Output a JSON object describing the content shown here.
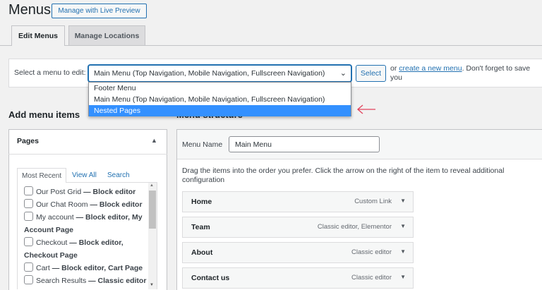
{
  "header": {
    "title": "Menus",
    "live_preview": "Manage with Live Preview"
  },
  "tabs": [
    {
      "label": "Edit Menus",
      "active": true
    },
    {
      "label": "Manage Locations",
      "active": false
    }
  ],
  "select_bar": {
    "label": "Select a menu to edit:",
    "selected": "Main Menu (Top Navigation, Mobile Navigation, Fullscreen Navigation)",
    "select_button": "Select",
    "or": "or",
    "create_link": "create a new menu",
    "after": ". Don't forget to save you"
  },
  "dropdown": {
    "options": [
      "Footer Menu",
      "Main Menu (Top Navigation, Mobile Navigation, Fullscreen Navigation)",
      "Nested Pages"
    ],
    "highlighted": "Nested Pages",
    "highlight_color": "#3390ff",
    "arrow_color": "#e2445c"
  },
  "add_items": {
    "title": "Add menu items",
    "panel_title": "Pages",
    "tabs": [
      "Most Recent",
      "View All",
      "Search"
    ],
    "pages": [
      {
        "title": "Our Post Grid",
        "meta": "— Block editor"
      },
      {
        "title": "Our Chat Room",
        "meta": "— Block editor"
      },
      {
        "title": "My account",
        "meta": "— Block editor, My Account Page"
      },
      {
        "title": "Checkout",
        "meta": "— Block editor, Checkout Page"
      },
      {
        "title": "Cart",
        "meta": "— Block editor, Cart Page"
      },
      {
        "title": "Search Results",
        "meta": "— Classic editor"
      }
    ]
  },
  "structure": {
    "title": "Menu structure",
    "name_label": "Menu Name",
    "name_value": "Main Menu",
    "instructions": "Drag the items into the order you prefer. Click the arrow on the right of the item to reveal additional configuration",
    "items": [
      {
        "name": "Home",
        "type": "Custom Link"
      },
      {
        "name": "Team",
        "type": "Classic editor, Elementor"
      },
      {
        "name": "About",
        "type": "Classic editor"
      },
      {
        "name": "Contact us",
        "type": "Classic editor"
      }
    ]
  }
}
